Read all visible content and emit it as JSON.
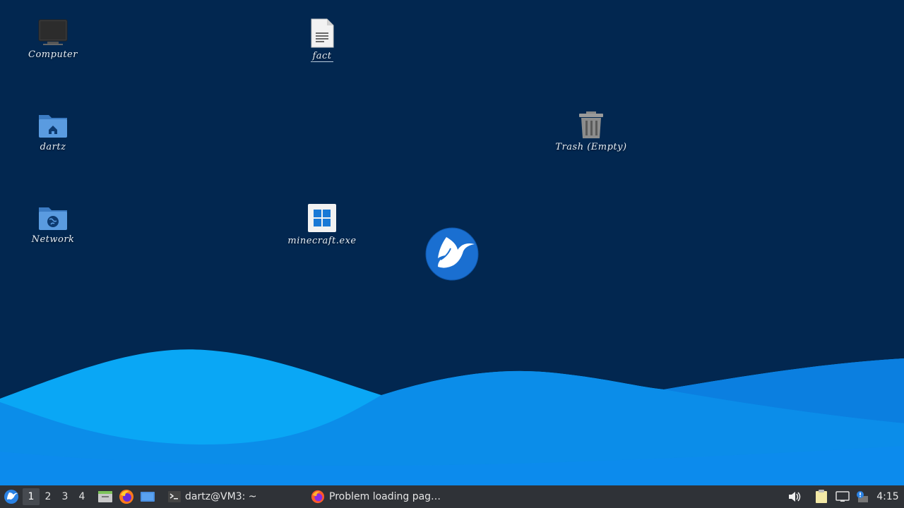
{
  "desktop": {
    "icons": [
      {
        "label": "Computer"
      },
      {
        "label": "dartz"
      },
      {
        "label": "Network"
      },
      {
        "label": "fact"
      },
      {
        "label": "minecraft.exe"
      },
      {
        "label": "Trash (Empty)"
      }
    ]
  },
  "taskbar": {
    "workspaces": [
      "1",
      "2",
      "3",
      "4"
    ],
    "active_workspace": "1",
    "launchers": [
      "files-icon",
      "firefox-icon",
      "show-desktop-icon"
    ],
    "tasks": [
      {
        "icon": "terminal-icon",
        "label": "dartz@VM3: ~"
      },
      {
        "icon": "firefox-icon",
        "label": "Problem loading pag…"
      }
    ],
    "tray": [
      "volume-icon",
      "clipboard-icon",
      "network-icon",
      "update-icon"
    ],
    "clock": "4:15"
  },
  "colors": {
    "desktop_bg": "#022750",
    "wave_light": "#0aa0f2",
    "wave_mid": "#0a84e8",
    "taskbar_bg": "#2f3237",
    "accent": "#1a6fd1"
  }
}
